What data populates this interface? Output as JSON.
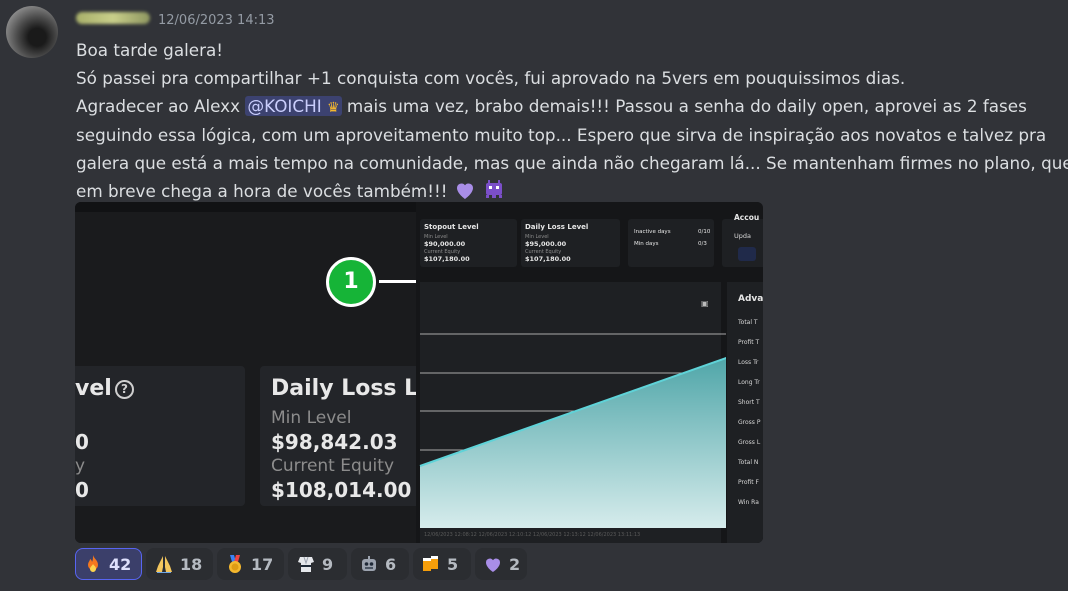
{
  "message": {
    "timestamp": "12/06/2023 14:13",
    "lines": {
      "l1": "Boa tarde galera!",
      "l2": "Só passei pra compartilhar +1 conquista com vocês, fui aprovado na 5vers em pouquissimos dias.",
      "l3a": "Agradecer ao Alexx ",
      "l3b": "  mais uma vez, brabo demais!!! Passou a senha do daily open, aprovei as 2 fases",
      "l4": "seguindo essa lógica, com um aproveitamento muito top... Espero que sirva de inspiração aos novatos e talvez pra",
      "l5": "galera que está a mais tempo na comunidade, mas que ainda não chegaram lá... Se mantenham firmes no plano, que",
      "l6": "em breve chega a hora de vocês também!!! "
    },
    "mention": "@KOICHI",
    "mention_icon": "crown-icon",
    "trailing_emojis": [
      "purple-heart-icon",
      "purple-invader-icon"
    ]
  },
  "attachment": {
    "left": {
      "badge": "1",
      "card_a": {
        "title": "vel",
        "frag1": "0",
        "frag2": "y",
        "frag3": "0"
      },
      "card_b": {
        "title": "Daily Loss Leve",
        "min_label": "Min Level",
        "min_value": "$98,842.03",
        "equity_label": "Current Equity",
        "equity_value": "$108,014.00"
      }
    },
    "right": {
      "stopout": {
        "title": "Stopout Level",
        "min_label": "Min Level",
        "min_value": "$90,000.00",
        "eq_label": "Current Equity",
        "eq_value": "$107,180.00"
      },
      "daily_loss": {
        "title": "Daily Loss Level",
        "min_label": "Min Level",
        "min_value": "$95,000.00",
        "eq_label": "Current Equity",
        "eq_value": "$107,180.00"
      },
      "days": {
        "inactive_label": "Inactive days",
        "inactive_value": "0/10",
        "min_label": "Min days",
        "min_value": "0/3"
      },
      "account": {
        "title": "Accou",
        "update": "Upda"
      },
      "advanced": {
        "title": "Adva",
        "items": [
          "Total T",
          "Profit T",
          "Loss Tr",
          "Long Tr",
          "Short T",
          "Gross P",
          "Gross L",
          "Total N",
          "Profit F",
          "Win Ra"
        ]
      },
      "x_labels": "12/06/2023  12:08:12     12/06/2023  12:10:12     12/06/2023  12:13:12     12/06/2023  13:11:13",
      "colors": {
        "line": "#5fd3d8",
        "fill_top": "#4aa3a6",
        "fill_bottom": "#d6ecec"
      }
    }
  },
  "reactions": [
    {
      "icon": "fire-icon",
      "count": "42",
      "active": true
    },
    {
      "icon": "folded-hands-icon",
      "count": "18",
      "active": false
    },
    {
      "icon": "medal-icon",
      "count": "17",
      "active": false
    },
    {
      "icon": "karate-gi-icon",
      "count": "9",
      "active": false
    },
    {
      "icon": "robot-face-icon",
      "count": "6",
      "active": false
    },
    {
      "icon": "beer-mugs-icon",
      "count": "5",
      "active": false
    },
    {
      "icon": "purple-heart-icon",
      "count": "2",
      "active": false
    }
  ]
}
